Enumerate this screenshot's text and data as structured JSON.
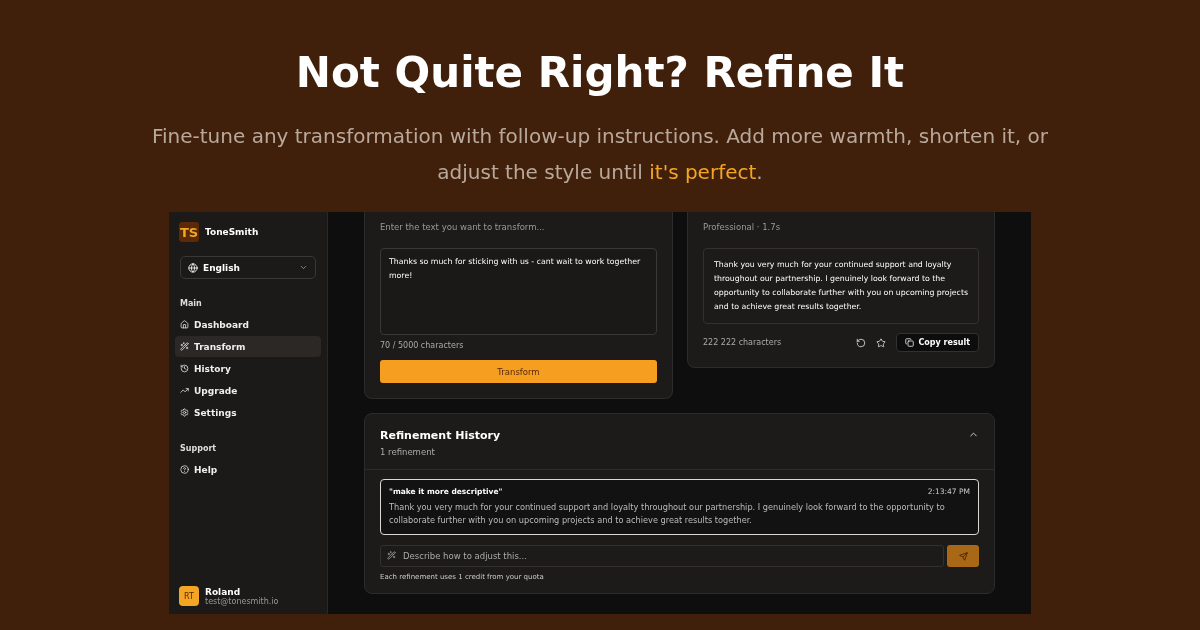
{
  "hero": {
    "title": "Not Quite Right? Refine It",
    "subtitle": "Fine-tune any transformation with follow-up instructions. Add more warmth, shorten it, or adjust the style until ",
    "highlight": "it's perfect",
    "end": "."
  },
  "sidebar": {
    "logo": "TS",
    "brand": "ToneSmith",
    "language": "English",
    "sections": [
      {
        "label": "Main",
        "items": [
          {
            "label": "Dashboard",
            "selected": false
          },
          {
            "label": "Transform",
            "selected": true
          },
          {
            "label": "History",
            "selected": false
          },
          {
            "label": "Upgrade",
            "selected": false
          },
          {
            "label": "Settings",
            "selected": false
          }
        ]
      },
      {
        "label": "Support",
        "items": [
          {
            "label": "Help",
            "selected": false
          }
        ]
      }
    ],
    "user": {
      "initials": "RT",
      "name": "Roland",
      "email": "test@tonesmith.io"
    }
  },
  "input_card": {
    "subtitle": "Enter the text you want to transform...",
    "text": "Thanks so much for sticking with us - cant wait to work together more!",
    "count": "70 / 5000 characters",
    "button": "Transform"
  },
  "output_card": {
    "subtitle": "Professional · 1.7s",
    "text": "Thank you very much for your continued support and loyalty throughout our partnership. I genuinely look forward to the opportunity to collaborate further with you on upcoming projects and to achieve great results together.",
    "count": "222 222 characters",
    "copy": "Copy result"
  },
  "refinement": {
    "title": "Refinement History",
    "count": "1 refinement",
    "expanded": true,
    "entries": [
      {
        "prompt": "\"make it more descriptive\"",
        "time": "2:13:47 PM",
        "text": "Thank you very much for your continued support and loyalty throughout our partnership. I genuinely look forward to the opportunity to collaborate further with you on upcoming projects and to achieve great results together."
      }
    ],
    "placeholder": "Describe how to adjust this...",
    "note": "Each refinement uses 1 credit from your quota"
  }
}
